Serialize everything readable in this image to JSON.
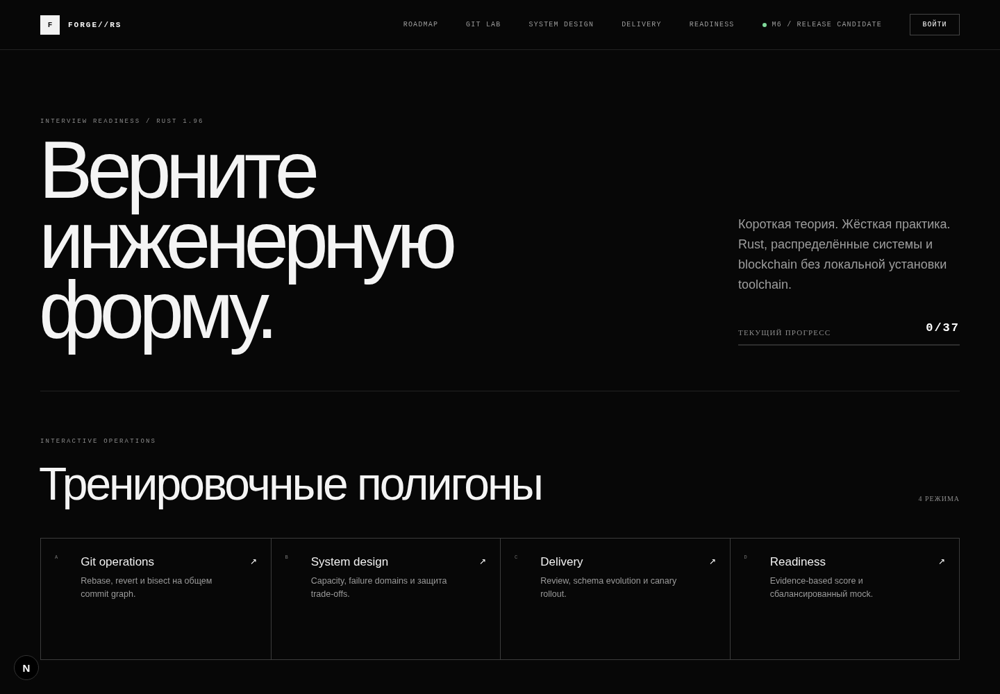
{
  "header": {
    "logo_mark": "F",
    "brand": "FORGE//RS",
    "nav": [
      {
        "label": "ROADMAP"
      },
      {
        "label": "GIT LAB"
      },
      {
        "label": "SYSTEM DESIGN"
      },
      {
        "label": "DELIVERY"
      },
      {
        "label": "READINESS"
      }
    ],
    "status": {
      "label": "M6 / RELEASE CANDIDATE"
    },
    "login_button": "ВОЙТИ"
  },
  "hero": {
    "eyebrow": "INTERVIEW READINESS / RUST 1.96",
    "title": "Верните инженерную форму.",
    "lead": "Короткая теория. Жёсткая практика. Rust, распределённые системы и blockchain без локальной установки toolchain.",
    "progress": {
      "label": "ТЕКУЩИЙ ПРОГРЕСС",
      "value": "0/37",
      "level": 0
    }
  },
  "modes": {
    "eyebrow": "INTERACTIVE OPERATIONS",
    "title": "Тренировочные полигоны",
    "count": "4 РЕЖИМА",
    "cards": [
      {
        "letter": "A",
        "title": "Git operations",
        "description": "Rebase, revert и bisect на общем commit graph.",
        "arrow": "↗"
      },
      {
        "letter": "B",
        "title": "System design",
        "description": "Capacity, failure domains и защита trade-offs.",
        "arrow": "↗"
      },
      {
        "letter": "C",
        "title": "Delivery",
        "description": "Review, schema evolution и canary rollout.",
        "arrow": "↗"
      },
      {
        "letter": "D",
        "title": "Readiness",
        "description": "Evidence-based score и сбалансированный mock.",
        "arrow": "↗"
      }
    ]
  },
  "dev_badge": {
    "label": "N"
  }
}
